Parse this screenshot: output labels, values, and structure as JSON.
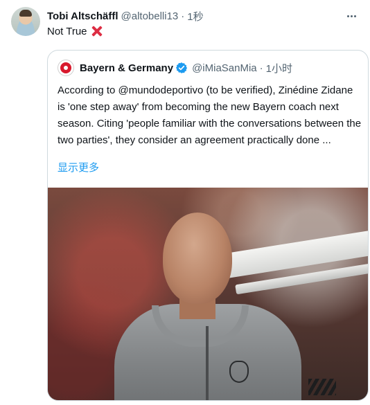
{
  "tweet": {
    "author_name": "Tobi Altschäffl",
    "author_handle": "@altobelli13",
    "separator": "·",
    "time": "1秒",
    "text": "Not True",
    "emoji_icon": "cross-mark-icon",
    "more_icon": "more-horizontal-icon"
  },
  "quote": {
    "author_name": "Bayern & Germany",
    "verified_icon": "verified-badge-icon",
    "author_handle": "@iMiaSanMia",
    "separator": "·",
    "time": "1小时",
    "body": "According to @mundodeportivo (to be verified), Zinédine Zidane is 'one step away' from becoming the new Bayern coach next season. Citing 'people familiar with the conversations between the two parties', they consider an agreement practically done ...",
    "show_more": "显示更多",
    "image_icon": "photo-zidane"
  },
  "colors": {
    "text_primary": "#0f1419",
    "text_secondary": "#536471",
    "link": "#1d9bf0",
    "border": "#cfd9de",
    "cross": "#dd2e44"
  }
}
